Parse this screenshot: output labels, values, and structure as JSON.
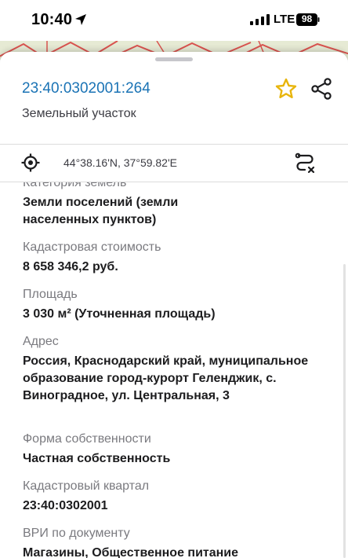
{
  "status_bar": {
    "time": "10:40",
    "network": "LTE",
    "battery": "98"
  },
  "parcel": {
    "cadastral_number": "23:40:0302001:264",
    "type": "Земельный участок",
    "coordinates": "44°38.16'N, 37°59.82'E"
  },
  "icons": {
    "favorite": "star-icon",
    "share": "share-icon",
    "locate": "target-icon",
    "route": "route-icon"
  },
  "colors": {
    "link": "#1a73b5",
    "star": "#e8b50c"
  },
  "fields": [
    {
      "label": "Категория земель",
      "value": "Земли поселений (земли населенных пунктов)"
    },
    {
      "label": "Кадастровая стоимость",
      "value": "8 658 346,2 руб."
    },
    {
      "label": "Площадь",
      "value": "3 030 м² (Уточненная площадь)"
    },
    {
      "label": "Адрес",
      "value": "Россия, Краснодарский край, муниципальное образование город-курорт Геленджик, с. Виноградное, ул. Центральная, 3"
    },
    {
      "label": "Форма собственности",
      "value": "Частная собственность"
    },
    {
      "label": "Кадастровый квартал",
      "value": "23:40:0302001"
    },
    {
      "label": "ВРИ по документу",
      "value": "Магазины, Общественное питание"
    }
  ]
}
